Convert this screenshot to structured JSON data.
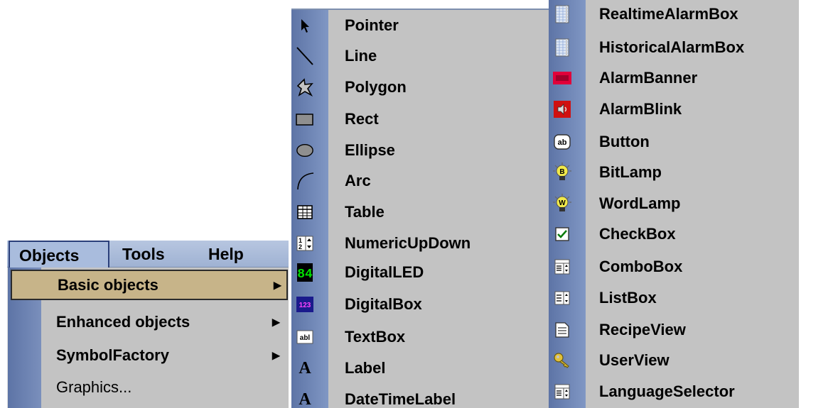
{
  "menubar": {
    "items": [
      {
        "label": "Objects",
        "open": true
      },
      {
        "label": "Tools",
        "open": false
      },
      {
        "label": "Help",
        "open": false
      }
    ]
  },
  "objects_menu": {
    "items": [
      {
        "label": "Basic objects",
        "has_submenu": true,
        "selected": true
      },
      {
        "label": "Enhanced objects",
        "has_submenu": true,
        "selected": false
      },
      {
        "label": "SymbolFactory",
        "has_submenu": true,
        "selected": false
      },
      {
        "label": "Graphics...",
        "has_submenu": false,
        "selected": false
      }
    ],
    "submenu_arrow": "▶"
  },
  "basic_objects": {
    "column1": [
      {
        "label": "Pointer",
        "icon": "pointer-icon"
      },
      {
        "label": "Line",
        "icon": "line-icon"
      },
      {
        "label": "Polygon",
        "icon": "polygon-icon"
      },
      {
        "label": "Rect",
        "icon": "rect-icon"
      },
      {
        "label": "Ellipse",
        "icon": "ellipse-icon"
      },
      {
        "label": "Arc",
        "icon": "arc-icon"
      },
      {
        "label": "Table",
        "icon": "table-icon"
      },
      {
        "label": "NumericUpDown",
        "icon": "numeric-updown-icon"
      },
      {
        "label": "DigitalLED",
        "icon": "digital-led-icon"
      },
      {
        "label": "DigitalBox",
        "icon": "digital-box-icon"
      },
      {
        "label": "TextBox",
        "icon": "textbox-icon"
      },
      {
        "label": "Label",
        "icon": "label-icon"
      },
      {
        "label": "DateTimeLabel",
        "icon": "datetime-label-icon"
      }
    ],
    "column2": [
      {
        "label": "RealtimeAlarmBox",
        "icon": "realtime-alarmbox-icon"
      },
      {
        "label": "HistoricalAlarmBox",
        "icon": "historical-alarmbox-icon"
      },
      {
        "label": "AlarmBanner",
        "icon": "alarm-banner-icon"
      },
      {
        "label": "AlarmBlink",
        "icon": "alarm-blink-icon"
      },
      {
        "label": "Button",
        "icon": "button-icon"
      },
      {
        "label": "BitLamp",
        "icon": "bitlamp-icon"
      },
      {
        "label": "WordLamp",
        "icon": "wordlamp-icon"
      },
      {
        "label": "CheckBox",
        "icon": "checkbox-icon"
      },
      {
        "label": "ComboBox",
        "icon": "combobox-icon"
      },
      {
        "label": "ListBox",
        "icon": "listbox-icon"
      },
      {
        "label": "RecipeView",
        "icon": "recipeview-icon"
      },
      {
        "label": "UserView",
        "icon": "userview-icon"
      },
      {
        "label": "LanguageSelector",
        "icon": "language-selector-icon"
      }
    ]
  },
  "icon_glyphs": {
    "digital_led_text": "84",
    "digital_box_text": "123",
    "textbox_text": "abl",
    "button_text": "ab",
    "label_glyph": "A",
    "bitlamp_letter": "B",
    "wordlamp_letter": "W",
    "numeric_updown_digits": "12"
  },
  "colors": {
    "menubar": "#a9bcdd",
    "menu_bg": "#c3c3c3",
    "strip": "#6b81b0",
    "selected": "#c7b489",
    "alarm_red": "#e0003a",
    "lamp_yellow": "#f1e94a",
    "led_green": "#00e000"
  }
}
